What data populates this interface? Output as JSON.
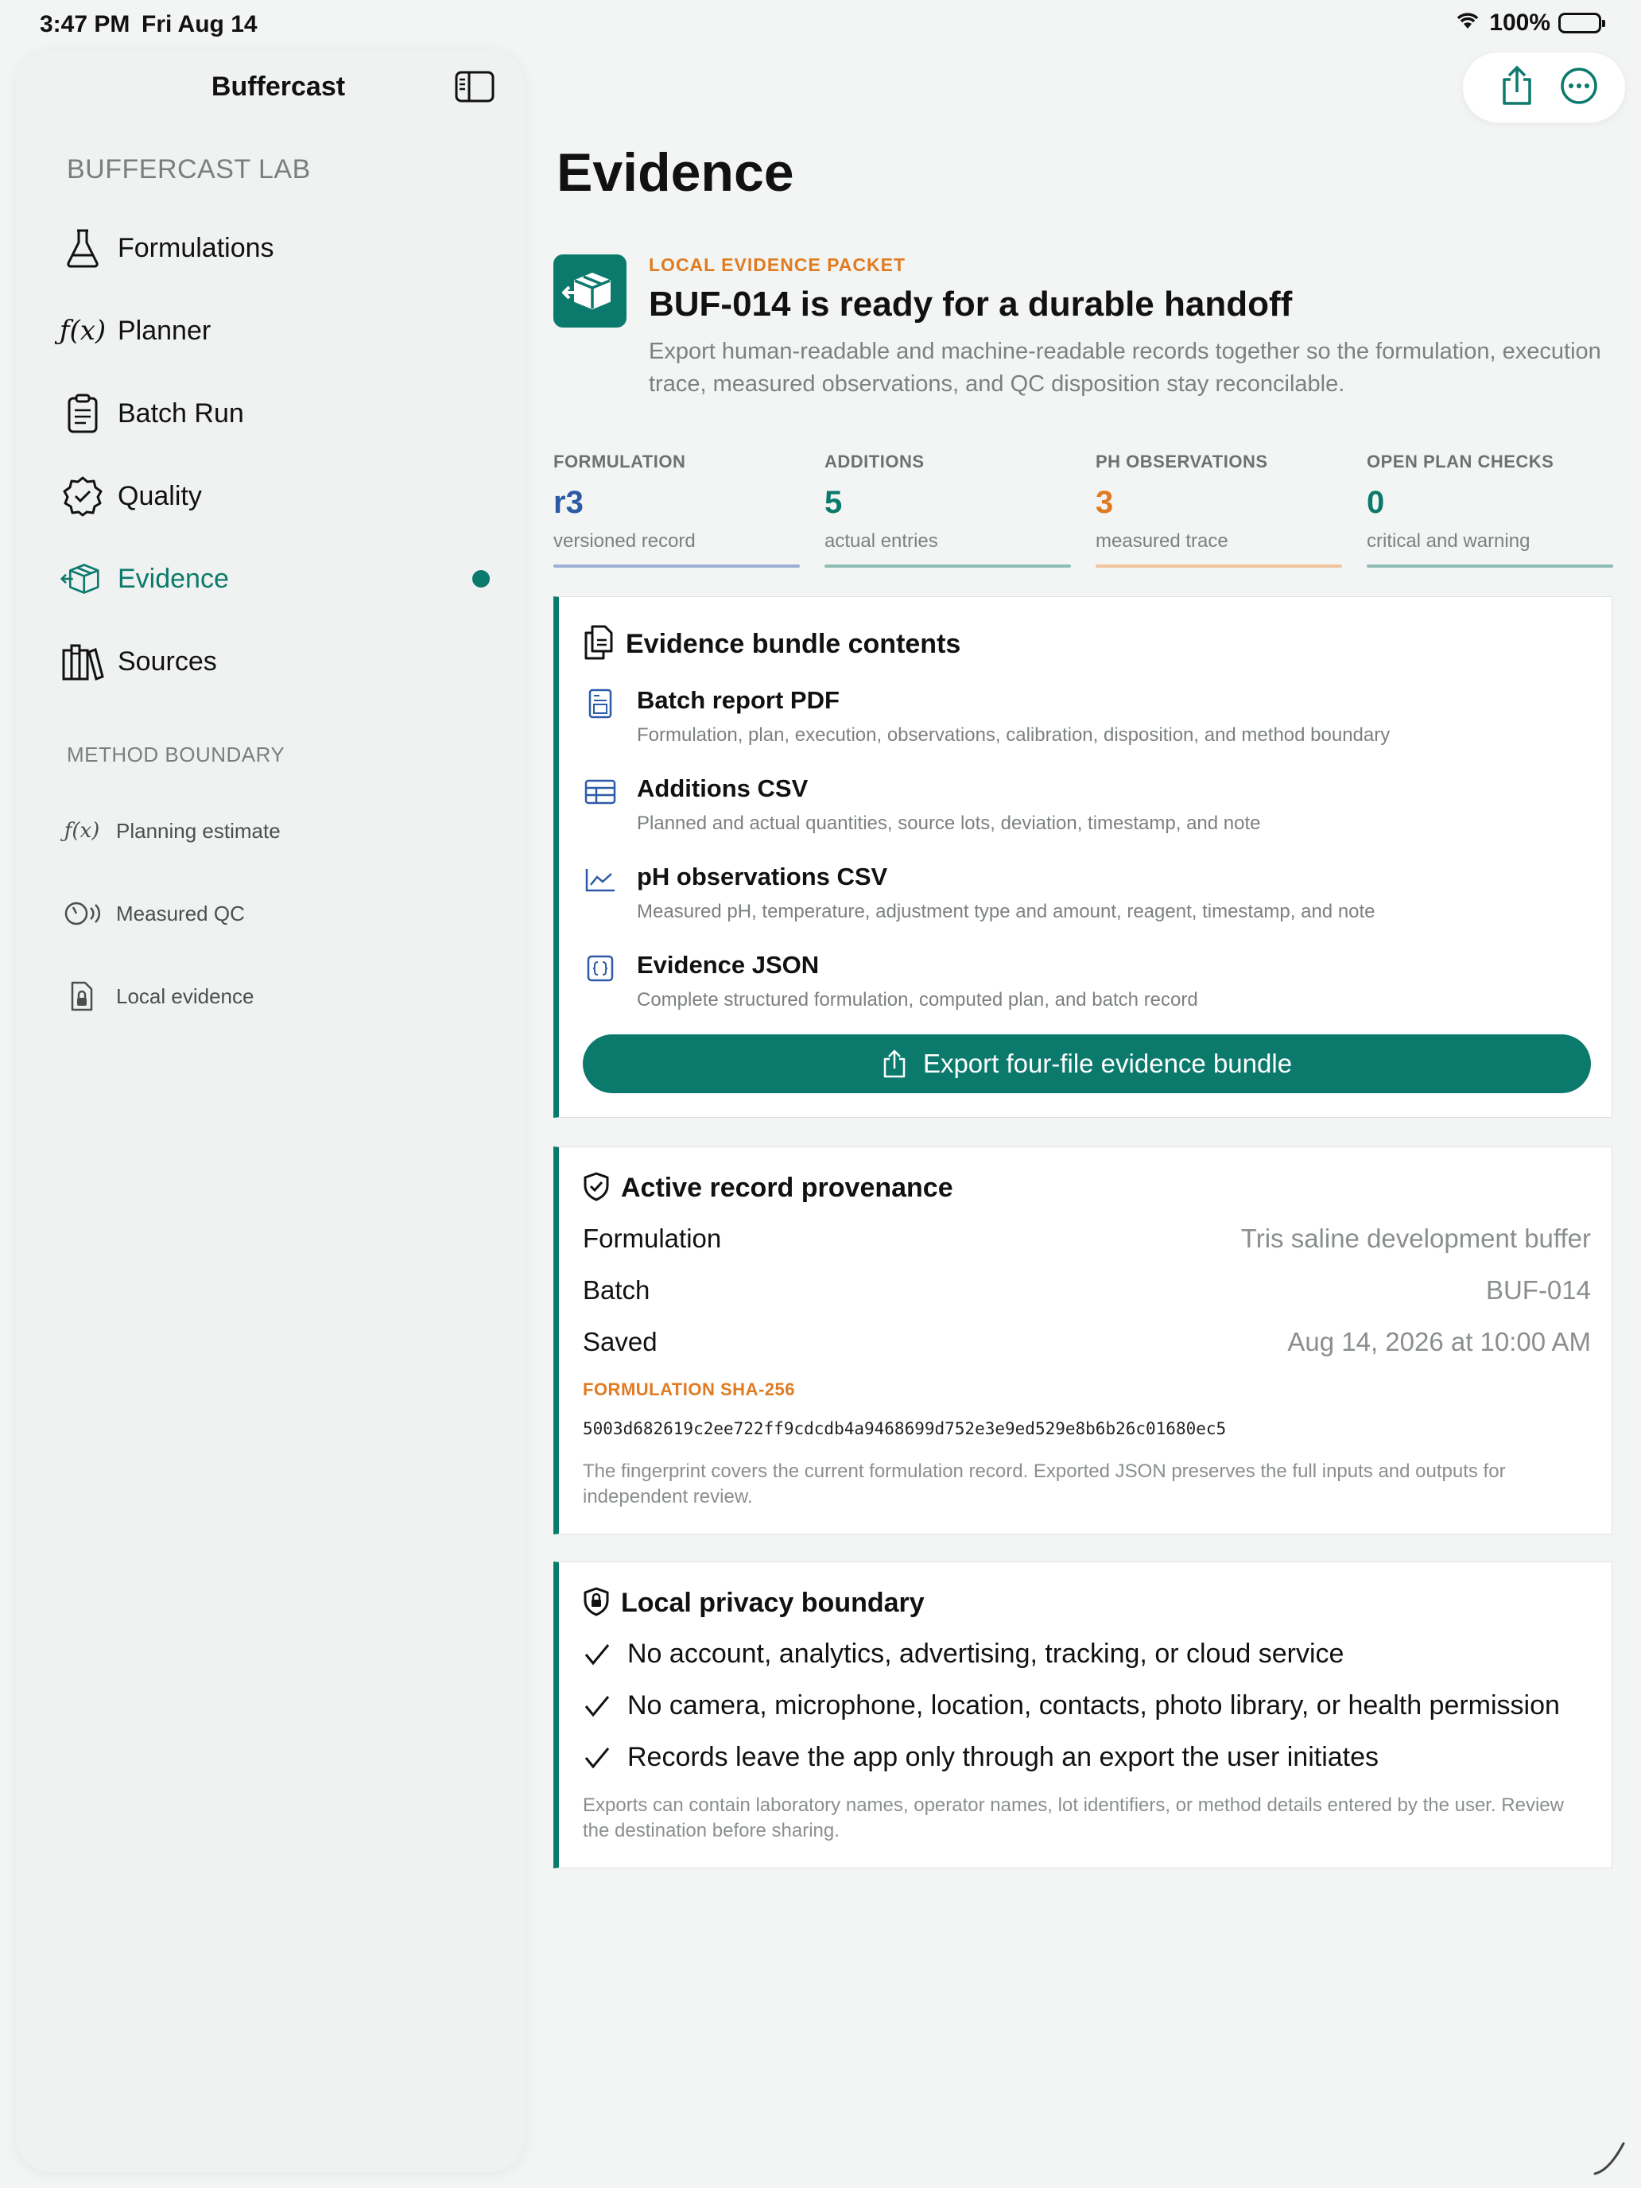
{
  "status": {
    "time": "3:47 PM",
    "date": "Fri Aug 14",
    "battery": "100%"
  },
  "sidebar": {
    "title": "Buffercast",
    "section_lab": "BUFFERCAST LAB",
    "items": [
      {
        "label": "Formulations",
        "icon": "flask-icon"
      },
      {
        "label": "Planner",
        "icon": "function-icon"
      },
      {
        "label": "Batch Run",
        "icon": "clipboard-icon"
      },
      {
        "label": "Quality",
        "icon": "seal-check-icon"
      },
      {
        "label": "Evidence",
        "icon": "shipping-box-icon",
        "active": true
      },
      {
        "label": "Sources",
        "icon": "books-icon"
      }
    ],
    "section_method": "METHOD BOUNDARY",
    "method_items": [
      {
        "label": "Planning estimate",
        "icon": "function-icon"
      },
      {
        "label": "Measured QC",
        "icon": "gauge-icon"
      },
      {
        "label": "Local evidence",
        "icon": "lock-document-icon"
      }
    ]
  },
  "page": {
    "title": "Evidence"
  },
  "hero": {
    "kicker": "LOCAL EVIDENCE PACKET",
    "title": "BUF-014 is ready for a durable handoff",
    "description": "Export human-readable and machine-readable records together so the formulation, execution trace, measured observations, and QC disposition stay reconcilable."
  },
  "stats": [
    {
      "label": "FORMULATION",
      "value": "r3",
      "sub": "versioned record",
      "color": "#2d5aa6",
      "bar": "#9db0d4"
    },
    {
      "label": "ADDITIONS",
      "value": "5",
      "sub": "actual entries",
      "color": "#0b7a6c",
      "bar": "#8fbdb6"
    },
    {
      "label": "PH OBSERVATIONS",
      "value": "3",
      "sub": "measured trace",
      "color": "#e07b22",
      "bar": "#f1c39c"
    },
    {
      "label": "OPEN PLAN CHECKS",
      "value": "0",
      "sub": "critical and warning",
      "color": "#0b7a6c",
      "bar": "#8fbdb6"
    }
  ],
  "bundle": {
    "title": "Evidence bundle contents",
    "items": [
      {
        "title": "Batch report PDF",
        "desc": "Formulation, plan, execution, observations, calibration, disposition, and method boundary",
        "icon": "report-icon"
      },
      {
        "title": "Additions CSV",
        "desc": "Planned and actual quantities, source lots, deviation, timestamp, and note",
        "icon": "table-icon"
      },
      {
        "title": "pH observations CSV",
        "desc": "Measured pH, temperature, adjustment type and amount, reagent, timestamp, and note",
        "icon": "chart-line-icon"
      },
      {
        "title": "Evidence JSON",
        "desc": "Complete structured formulation, computed plan, and batch record",
        "icon": "code-braces-icon"
      }
    ],
    "export_label": "Export four-file evidence bundle"
  },
  "provenance": {
    "title": "Active record provenance",
    "rows": [
      {
        "label": "Formulation",
        "value": "Tris saline development buffer"
      },
      {
        "label": "Batch",
        "value": "BUF-014"
      },
      {
        "label": "Saved",
        "value": "Aug 14, 2026 at 10:00 AM"
      }
    ],
    "sha_label": "FORMULATION SHA-256",
    "sha_value": "5003d682619c2ee722ff9cdcdb4a9468699d752e3e9ed529e8b6b26c01680ec5",
    "note": "The fingerprint covers the current formulation record. Exported JSON preserves the full inputs and outputs for independent review."
  },
  "privacy": {
    "title": "Local privacy boundary",
    "checks": [
      "No account, analytics, advertising, tracking, or cloud service",
      "No camera, microphone, location, contacts, photo library, or health permission",
      "Records leave the app only through an export the user initiates"
    ],
    "note": "Exports can contain laboratory names, operator names, lot identifiers, or method details entered by the user. Review the destination before sharing."
  },
  "colors": {
    "accent": "#0b7a6c",
    "warning": "#e07b22",
    "info": "#2d5aa6"
  }
}
